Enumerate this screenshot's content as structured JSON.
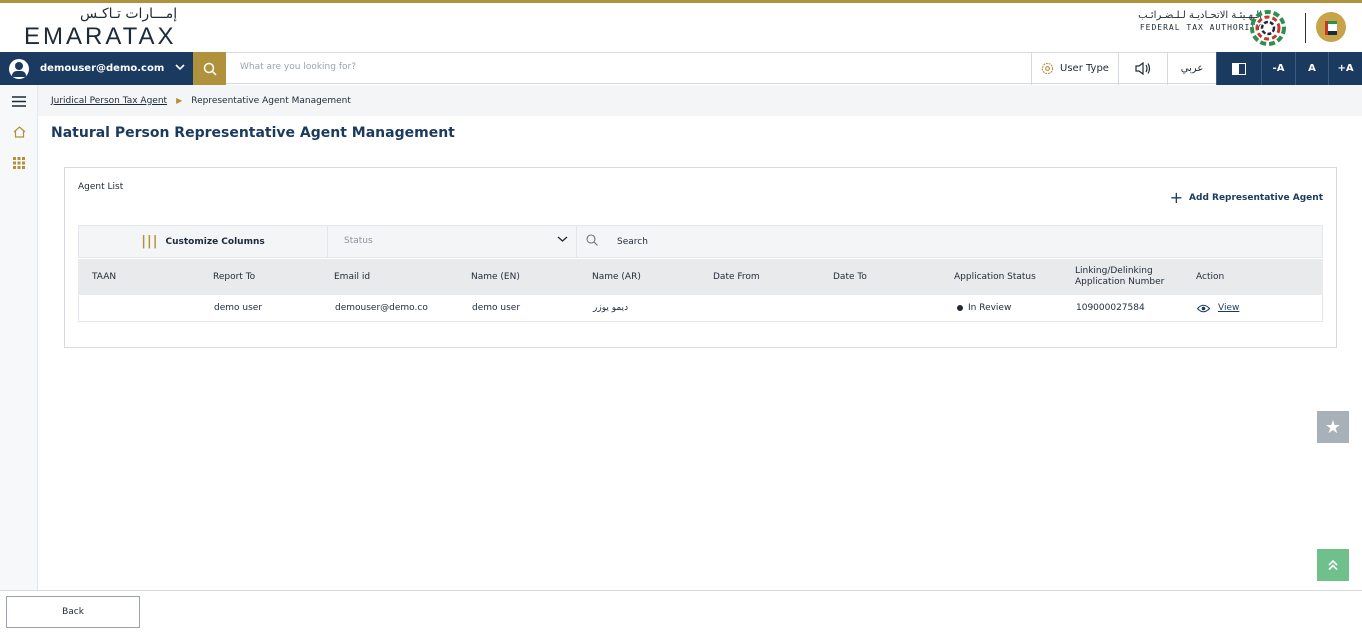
{
  "header": {
    "logo_ar": "إمـــارات تـاكـس",
    "logo_en": "EMARATAX",
    "fta_ar": "الـهـيئـة الاتحـاديـة لـلـضـرائـب",
    "fta_en": "FEDERAL TAX AUTHORITY"
  },
  "toolbar": {
    "user_email": "demouser@demo.com",
    "search_placeholder": "What are you looking for?",
    "user_type": "User Type",
    "language": "عربي",
    "font_decrease": "-A",
    "font_default": "A",
    "font_increase": "+A"
  },
  "breadcrumb": {
    "parent": "Juridical Person Tax Agent",
    "current": "Representative Agent Management"
  },
  "page": {
    "title": "Natural Person Representative Agent Management"
  },
  "agent_list": {
    "title": "Agent List",
    "add_button": "Add Representative Agent",
    "customize_columns": "Customize Columns",
    "status_placeholder": "Status",
    "search_placeholder": "Search",
    "columns": [
      "TAAN",
      "Report To",
      "Email id",
      "Name (EN)",
      "Name (AR)",
      "Date From",
      "Date To",
      "Application Status",
      "Linking/Delinking Application Number",
      "Action"
    ],
    "rows": [
      {
        "taan": "",
        "report_to": "demo user",
        "email": "demouser@demo.co",
        "name_en": "demo user",
        "name_ar": "ديمو يوزر",
        "date_from": "",
        "date_to": "",
        "status": "In Review",
        "app_number": "109000027584",
        "action": "View"
      }
    ]
  },
  "footer": {
    "back_label": "Back"
  },
  "colors": {
    "primary": "#1b3a5f",
    "accent_gold": "#b0913c",
    "scroll_top_green": "#6fc08a"
  }
}
